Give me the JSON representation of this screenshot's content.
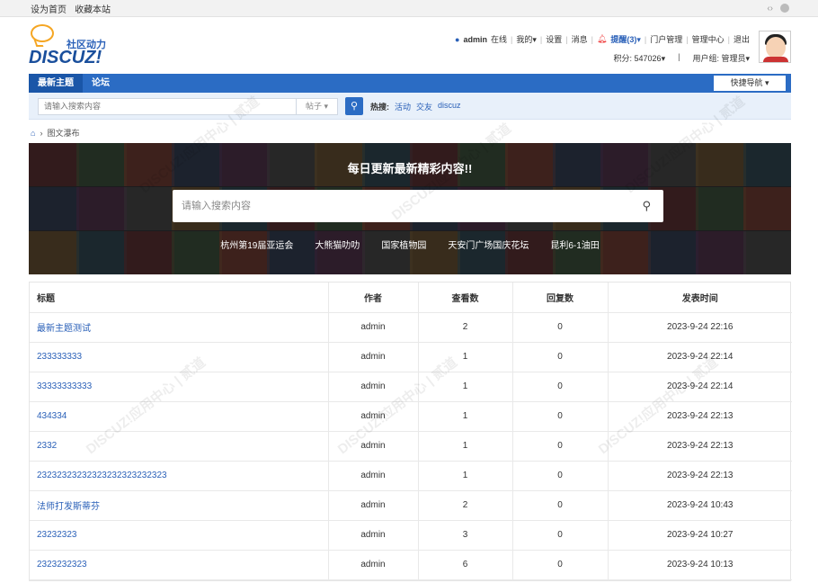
{
  "topbar": {
    "set_home": "设为首页",
    "bookmark": "收藏本站"
  },
  "logo": {
    "tagline": "社区动力",
    "brand": "DISCUZ!"
  },
  "userbar": {
    "username": "admin",
    "status": "在线",
    "mine": "我的",
    "settings": "设置",
    "messages": "消息",
    "alerts": "提醒(3)",
    "portal_admin": "门户管理",
    "admin_center": "管理中心",
    "logout": "退出",
    "points": "积分: 547026",
    "group": "用户组: 管理员"
  },
  "nav": {
    "items": [
      {
        "label": "最新主题"
      },
      {
        "label": "论坛"
      }
    ],
    "quick_nav": "快捷导航"
  },
  "search": {
    "placeholder": "请输入搜索内容",
    "type": "帖子",
    "hot_label": "热搜:",
    "hot_terms": [
      "活动",
      "交友",
      "discuz"
    ]
  },
  "breadcrumb": {
    "current": "图文瀑布"
  },
  "banner": {
    "title": "每日更新最新精彩内容!!",
    "search_placeholder": "请输入搜索内容",
    "tags": [
      "杭州第19届亚运会",
      "大熊猫叻叻",
      "国家植物园",
      "天安门广场国庆花坛",
      "昆利6-1油田"
    ]
  },
  "table": {
    "headers": [
      "标题",
      "作者",
      "查看数",
      "回复数",
      "发表时间"
    ],
    "rows": [
      [
        "最新主题测试",
        "admin",
        "2",
        "0",
        "2023-9-24 22:16"
      ],
      [
        "233333333",
        "admin",
        "1",
        "0",
        "2023-9-24 22:14"
      ],
      [
        "33333333333",
        "admin",
        "1",
        "0",
        "2023-9-24 22:14"
      ],
      [
        "434334",
        "admin",
        "1",
        "0",
        "2023-9-24 22:13"
      ],
      [
        "2332",
        "admin",
        "1",
        "0",
        "2023-9-24 22:13"
      ],
      [
        "23232323232323232323232323",
        "admin",
        "1",
        "0",
        "2023-9-24 22:13"
      ],
      [
        "法师打发斯蒂芬",
        "admin",
        "2",
        "0",
        "2023-9-24 10:43"
      ],
      [
        "23232323",
        "admin",
        "3",
        "0",
        "2023-9-24 10:27"
      ],
      [
        "2323232323",
        "admin",
        "6",
        "0",
        "2023-9-24 10:13"
      ]
    ]
  },
  "colors": {
    "nav_blue": "#2b6cc4",
    "link_blue": "#2a60b8",
    "alert_red": "#ee3333"
  }
}
